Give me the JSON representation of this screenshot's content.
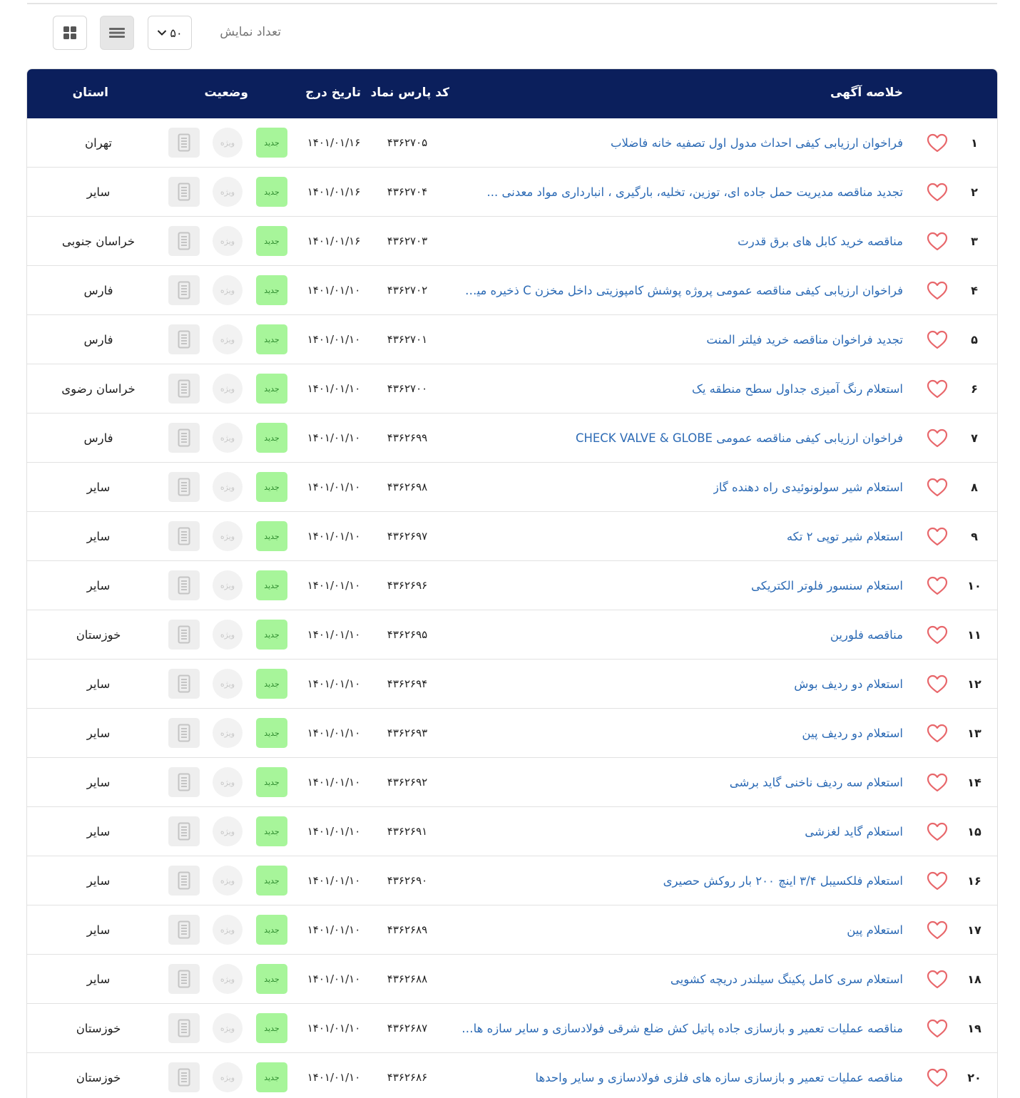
{
  "toolbar": {
    "display_count_label": "تعداد نمایش",
    "page_size": "۵۰",
    "grid_view_icon": "grid-icon",
    "list_view_icon": "list-icon"
  },
  "table": {
    "headers": {
      "summary": "خلاصه آگهی",
      "code": "کد پارس نماد",
      "date": "تاریخ درج",
      "status": "وضعیت",
      "province": "استان"
    },
    "badge_new": "جدید",
    "badge_vip": "ویژه",
    "colors": {
      "header_bg": "#0b1f5c",
      "link": "#2d6bb5",
      "new_badge": "#a7f59a",
      "heart": "#e8676b"
    },
    "rows": [
      {
        "num": "۱",
        "title": "فراخوان ارزیابی کیفی احداث مدول اول تصفیه خانه فاضلاب",
        "code": "۴۳۶۲۷۰۵",
        "date": "۱۴۰۱/۰۱/۱۶",
        "province": "تهران"
      },
      {
        "num": "۲",
        "title": "تجدید مناقصه  مدیریت حمل جاده ای، توزین، تخلیه، بارگیری ، انبارداری مواد معدنی ...",
        "code": "۴۳۶۲۷۰۴",
        "date": "۱۴۰۱/۰۱/۱۶",
        "province": "سایر"
      },
      {
        "num": "۳",
        "title": "مناقصه خرید کابل های برق قدرت",
        "code": "۴۳۶۲۷۰۳",
        "date": "۱۴۰۱/۰۱/۱۶",
        "province": "خراسان جنوبی"
      },
      {
        "num": "۴",
        "title": "فراخوان ارزیابی کیفی مناقصه عمومی پروژه پوشش کامپوزیتی داخل مخزن C ذخیره میعا...",
        "code": "۴۳۶۲۷۰۲",
        "date": "۱۴۰۱/۰۱/۱۰",
        "province": "فارس"
      },
      {
        "num": "۵",
        "title": "تجدید فراخوان مناقصه خرید فیلتر المنت",
        "code": "۴۳۶۲۷۰۱",
        "date": "۱۴۰۱/۰۱/۱۰",
        "province": "فارس"
      },
      {
        "num": "۶",
        "title": "استعلام رنگ آمیزی جداول سطح منطقه یک",
        "code": "۴۳۶۲۷۰۰",
        "date": "۱۴۰۱/۰۱/۱۰",
        "province": "خراسان رضوی"
      },
      {
        "num": "۷",
        "title": "فراخوان ارزیابی کیفی مناقصه عمومی CHECK VALVE & GLOBE",
        "code": "۴۳۶۲۶۹۹",
        "date": "۱۴۰۱/۰۱/۱۰",
        "province": "فارس"
      },
      {
        "num": "۸",
        "title": "استعلام شیر سولونوئیدی راه دهنده گاز",
        "code": "۴۳۶۲۶۹۸",
        "date": "۱۴۰۱/۰۱/۱۰",
        "province": "سایر"
      },
      {
        "num": "۹",
        "title": "استعلام شیر توپی ۲ تکه",
        "code": "۴۳۶۲۶۹۷",
        "date": "۱۴۰۱/۰۱/۱۰",
        "province": "سایر"
      },
      {
        "num": "۱۰",
        "title": "استعلام سنسور فلوتر الکتریکی",
        "code": "۴۳۶۲۶۹۶",
        "date": "۱۴۰۱/۰۱/۱۰",
        "province": "سایر"
      },
      {
        "num": "۱۱",
        "title": "مناقصه فلورین",
        "code": "۴۳۶۲۶۹۵",
        "date": "۱۴۰۱/۰۱/۱۰",
        "province": "خوزستان"
      },
      {
        "num": "۱۲",
        "title": "استعلام دو ردیف بوش",
        "code": "۴۳۶۲۶۹۴",
        "date": "۱۴۰۱/۰۱/۱۰",
        "province": "سایر"
      },
      {
        "num": "۱۳",
        "title": "استعلام دو ردیف پین",
        "code": "۴۳۶۲۶۹۳",
        "date": "۱۴۰۱/۰۱/۱۰",
        "province": "سایر"
      },
      {
        "num": "۱۴",
        "title": "استعلام سه ردیف ناخنی گاید برشی",
        "code": "۴۳۶۲۶۹۲",
        "date": "۱۴۰۱/۰۱/۱۰",
        "province": "سایر"
      },
      {
        "num": "۱۵",
        "title": "استعلام گاید لغزشی",
        "code": "۴۳۶۲۶۹۱",
        "date": "۱۴۰۱/۰۱/۱۰",
        "province": "سایر"
      },
      {
        "num": "۱۶",
        "title": "استعلام فلکسیبل ۳/۴ اینچ ۲۰۰ بار روکش حصیری",
        "code": "۴۳۶۲۶۹۰",
        "date": "۱۴۰۱/۰۱/۱۰",
        "province": "سایر"
      },
      {
        "num": "۱۷",
        "title": "استعلام پین",
        "code": "۴۳۶۲۶۸۹",
        "date": "۱۴۰۱/۰۱/۱۰",
        "province": "سایر"
      },
      {
        "num": "۱۸",
        "title": "استعلام سری کامل پکینگ سیلندر دریچه کشویی",
        "code": "۴۳۶۲۶۸۸",
        "date": "۱۴۰۱/۰۱/۱۰",
        "province": "سایر"
      },
      {
        "num": "۱۹",
        "title": "مناقصه عملیات تعمیر و بازسازی جاده پاتیل کش ضلع شرقی فولادسازی و سایر سازه های...",
        "code": "۴۳۶۲۶۸۷",
        "date": "۱۴۰۱/۰۱/۱۰",
        "province": "خوزستان"
      },
      {
        "num": "۲۰",
        "title": "مناقصه عملیات تعمیر و بازسازی سازه های فلزی فولادسازی و سایر واحدها",
        "code": "۴۳۶۲۶۸۶",
        "date": "۱۴۰۱/۰۱/۱۰",
        "province": "خوزستان"
      }
    ]
  }
}
